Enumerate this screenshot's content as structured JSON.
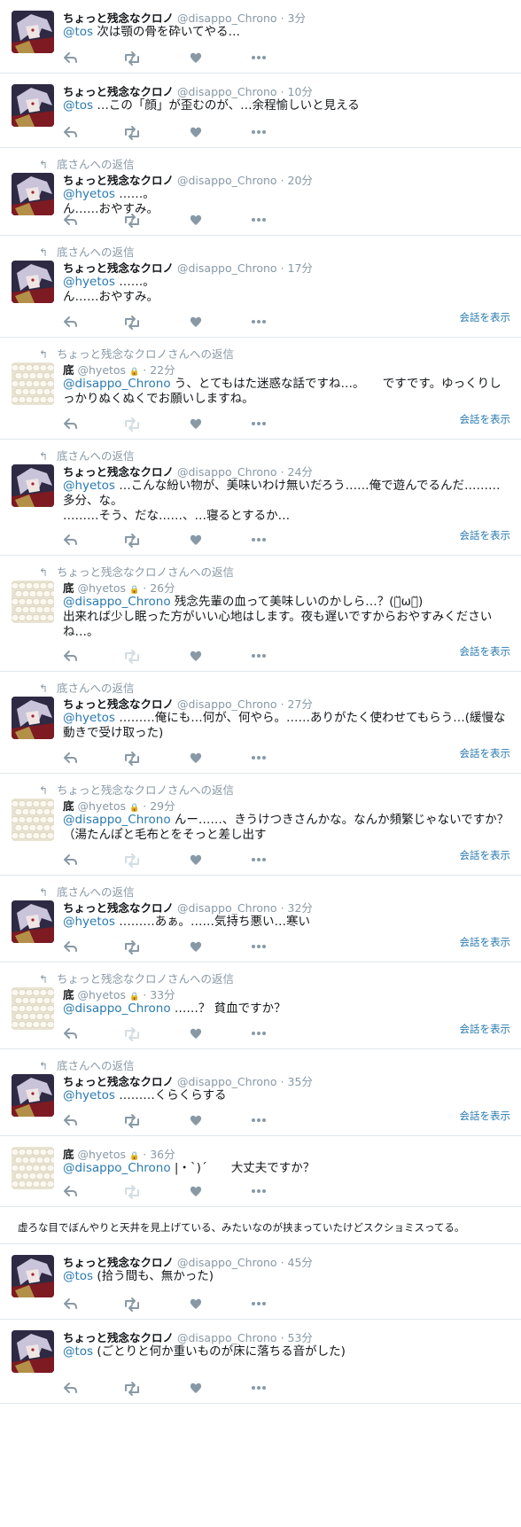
{
  "accounts": {
    "chrono": {
      "name": "ちょっと残念なクロノ",
      "handle": "@disappo_Chrono"
    },
    "soko": {
      "name": "底",
      "handle": "@hyetos"
    }
  },
  "labels": {
    "view_conversation": "会話を表示",
    "reply_to_soko": "底さんへの返信",
    "reply_to_chrono": "ちょっと残念なクロノさんへの返信"
  },
  "tweets": [
    {
      "author": "chrono",
      "time": "3分",
      "mention": "@tos",
      "text": " 次は顎の骨を砕いてやる…"
    },
    {
      "author": "chrono",
      "time": "10分",
      "mention": "@tos",
      "text": " …この「顔」が歪むのが、…余程愉しいと見える"
    },
    {
      "author": "chrono",
      "time": "20分",
      "context": "底さんへの返信",
      "mention": "@hyetos",
      "text": " ……。\nん……おやすみ。"
    },
    {
      "author": "chrono",
      "time": "17分",
      "context": "底さんへの返信",
      "mention": "@hyetos",
      "text": " ……。\nん……おやすみ。",
      "show_conversation": true
    },
    {
      "author": "soko",
      "time": "22分",
      "context": "ちょっと残念なクロノさんへの返信",
      "mention": "@disappo_Chrono",
      "text": " う、とてもはた迷惑な話ですね…。　　ですです。ゆっくりしっかりぬくぬくでお願いしますね。",
      "show_conversation": true
    },
    {
      "author": "chrono",
      "time": "24分",
      "context": "底さんへの返信",
      "mention": "@hyetos",
      "text": " …こんな紛い物が、美味いわけ無いだろう……俺で遊んでるんだ………多分、な。\n………そう、だな……、…寝るとするか…",
      "show_conversation": true
    },
    {
      "author": "soko",
      "time": "26分",
      "context": "ちょっと残念なクロノさんへの返信",
      "mention": "@disappo_Chrono",
      "text": " 残念先輩の血って美味しいのかしら…？(･̆ω･̆)\n出来れば少し眠った方がいい心地はします。夜も遅いですからおやすみくださいね…。",
      "show_conversation": true
    },
    {
      "author": "chrono",
      "time": "27分",
      "context": "底さんへの返信",
      "mention": "@hyetos",
      "text": " ………俺にも…何が、何やら。……ありがたく使わせてもらう…(緩慢な動きで受け取った)",
      "show_conversation": true
    },
    {
      "author": "soko",
      "time": "29分",
      "context": "ちょっと残念なクロノさんへの返信",
      "mention": "@disappo_Chrono",
      "text": " んー……、きうけつきさんかな。なんか頻繁じゃないですか？（湯たんぽと毛布とをそっと差し出す",
      "show_conversation": true
    },
    {
      "author": "chrono",
      "time": "32分",
      "context": "底さんへの返信",
      "mention": "@hyetos",
      "text": " ………あぁ。……気持ち悪い…寒い",
      "show_conversation": true
    },
    {
      "author": "soko",
      "time": "33分",
      "context": "ちょっと残念なクロノさんへの返信",
      "mention": "@disappo_Chrono",
      "text": " ……？ 貧血ですか？",
      "show_conversation": true
    },
    {
      "author": "chrono",
      "time": "35分",
      "context": "底さんへの返信",
      "mention": "@hyetos",
      "text": " ………くらくらする",
      "show_conversation": true
    },
    {
      "author": "soko",
      "time": "36分",
      "mention": "@disappo_Chrono",
      "text": " |・ˋ)ˊ　　大丈夫ですか？"
    },
    {
      "note": "虚ろな目でぼんやりと天井を見上げている、みたいなのが挟まっていたけどスクショミスってる。"
    },
    {
      "author": "chrono",
      "time": "45分",
      "mention": "@tos",
      "text": " (拾う間も、無かった)"
    },
    {
      "author": "chrono",
      "time": "53分",
      "mention": "@tos",
      "text": " (ごとりと何か重いものが床に落ちる音がした)"
    }
  ]
}
